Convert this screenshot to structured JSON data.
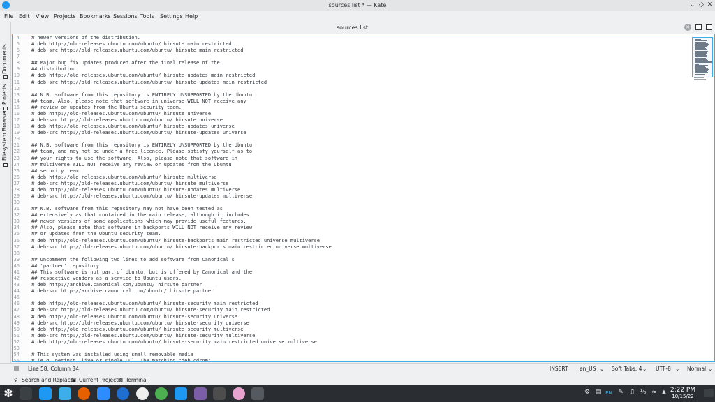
{
  "window": {
    "title": "sources.list * — Kate",
    "controls": [
      "minimize",
      "maximize",
      "close"
    ]
  },
  "menu": [
    "File",
    "Edit",
    "View",
    "Projects",
    "Bookmarks",
    "Sessions",
    "Tools",
    "Settings",
    "Help"
  ],
  "sidebar": {
    "tabs": [
      "Documents",
      "Projects",
      "Filesystem Browser"
    ]
  },
  "tab": {
    "title": "sources.list"
  },
  "editor": {
    "lines": [
      {
        "n": "4",
        "t": "# newer versions of the distribution."
      },
      {
        "n": "5",
        "t": "# deb http://old-releases.ubuntu.com/ubuntu/ hirsute main restricted"
      },
      {
        "n": "6",
        "t": "# deb-src http://old-releases.ubuntu.com/ubuntu/ hirsute main restricted"
      },
      {
        "n": "7",
        "t": ""
      },
      {
        "n": "8",
        "t": "## Major bug fix updates produced after the final release of the"
      },
      {
        "n": "9",
        "t": "## distribution."
      },
      {
        "n": "10",
        "t": "# deb http://old-releases.ubuntu.com/ubuntu/ hirsute-updates main restricted"
      },
      {
        "n": "11",
        "t": "# deb-src http://old-releases.ubuntu.com/ubuntu/ hirsute-updates main restricted"
      },
      {
        "n": "12",
        "t": ""
      },
      {
        "n": "13",
        "t": "## N.B. software from this repository is ENTIRELY UNSUPPORTED by the Ubuntu"
      },
      {
        "n": "14",
        "t": "## team. Also, please note that software in universe WILL NOT receive any"
      },
      {
        "n": "15",
        "t": "## review or updates from the Ubuntu security team."
      },
      {
        "n": "16",
        "t": "# deb http://old-releases.ubuntu.com/ubuntu/ hirsute universe"
      },
      {
        "n": "17",
        "t": "# deb-src http://old-releases.ubuntu.com/ubuntu/ hirsute universe"
      },
      {
        "n": "18",
        "t": "# deb http://old-releases.ubuntu.com/ubuntu/ hirsute-updates universe"
      },
      {
        "n": "19",
        "t": "# deb-src http://old-releases.ubuntu.com/ubuntu/ hirsute-updates universe"
      },
      {
        "n": "20",
        "t": ""
      },
      {
        "n": "21",
        "t": "## N.B. software from this repository is ENTIRELY UNSUPPORTED by the Ubuntu"
      },
      {
        "n": "22",
        "t": "## team, and may not be under a free licence. Please satisfy yourself as to"
      },
      {
        "n": "23",
        "t": "## your rights to use the software. Also, please note that software in"
      },
      {
        "n": "24",
        "t": "## multiverse WILL NOT receive any review or updates from the Ubuntu"
      },
      {
        "n": "25",
        "t": "## security team."
      },
      {
        "n": "26",
        "t": "# deb http://old-releases.ubuntu.com/ubuntu/ hirsute multiverse"
      },
      {
        "n": "27",
        "t": "# deb-src http://old-releases.ubuntu.com/ubuntu/ hirsute multiverse"
      },
      {
        "n": "28",
        "t": "# deb http://old-releases.ubuntu.com/ubuntu/ hirsute-updates multiverse"
      },
      {
        "n": "29",
        "t": "# deb-src http://old-releases.ubuntu.com/ubuntu/ hirsute-updates multiverse"
      },
      {
        "n": "30",
        "t": ""
      },
      {
        "n": "31",
        "t": "## N.B. software from this repository may not have been tested as"
      },
      {
        "n": "32",
        "t": "## extensively as that contained in the main release, although it includes"
      },
      {
        "n": "33",
        "t": "## newer versions of some applications which may provide useful features."
      },
      {
        "n": "34",
        "t": "## Also, please note that software in backports WILL NOT receive any review"
      },
      {
        "n": "35",
        "t": "## or updates from the Ubuntu security team."
      },
      {
        "n": "36",
        "t": "# deb http://old-releases.ubuntu.com/ubuntu/ hirsute-backports main restricted universe multiverse"
      },
      {
        "n": "37",
        "t": "# deb-src http://old-releases.ubuntu.com/ubuntu/ hirsute-backports main restricted universe multiverse"
      },
      {
        "n": "38",
        "t": ""
      },
      {
        "n": "39",
        "t": "## Uncomment the following two lines to add software from Canonical's"
      },
      {
        "n": "40",
        "t": "## 'partner' repository."
      },
      {
        "n": "41",
        "t": "## This software is not part of Ubuntu, but is offered by Canonical and the"
      },
      {
        "n": "42",
        "t": "## respective vendors as a service to Ubuntu users."
      },
      {
        "n": "43",
        "t": "# deb http://archive.canonical.com/ubuntu/ hirsute partner"
      },
      {
        "n": "44",
        "t": "# deb-src http://archive.canonical.com/ubuntu/ hirsute partner"
      },
      {
        "n": "45",
        "t": ""
      },
      {
        "n": "46",
        "t": "# deb http://old-releases.ubuntu.com/ubuntu/ hirsute-security main restricted"
      },
      {
        "n": "47",
        "t": "# deb-src http://old-releases.ubuntu.com/ubuntu/ hirsute-security main restricted"
      },
      {
        "n": "48",
        "t": "# deb http://old-releases.ubuntu.com/ubuntu/ hirsute-security universe"
      },
      {
        "n": "49",
        "t": "# deb-src http://old-releases.ubuntu.com/ubuntu/ hirsute-security universe"
      },
      {
        "n": "50",
        "t": "# deb http://old-releases.ubuntu.com/ubuntu/ hirsute-security multiverse"
      },
      {
        "n": "51",
        "t": "# deb-src http://old-releases.ubuntu.com/ubuntu/ hirsute-security multiverse"
      },
      {
        "n": "52",
        "t": "# deb http://old-releases.ubuntu.com/ubuntu/ hirsute-security main restricted universe multiverse"
      },
      {
        "n": "53",
        "t": ""
      },
      {
        "n": "54",
        "t": "# This system was installed using small removable media"
      },
      {
        "n": "55",
        "t": "# (e.g. netinst, live or single CD). The matching \"deb cdrom\""
      }
    ]
  },
  "status": {
    "position": "Line 58, Column 34",
    "mode": "INSERT",
    "language": "en_US",
    "indent": "Soft Tabs: 4",
    "encoding": "UTF-8",
    "highlight": "Normal"
  },
  "toolviews": [
    "Search and Replace",
    "Current Project",
    "Terminal"
  ],
  "taskbar": {
    "time": "2:22 PM",
    "date": "10/15/22",
    "keyboard_layout": "EN"
  }
}
